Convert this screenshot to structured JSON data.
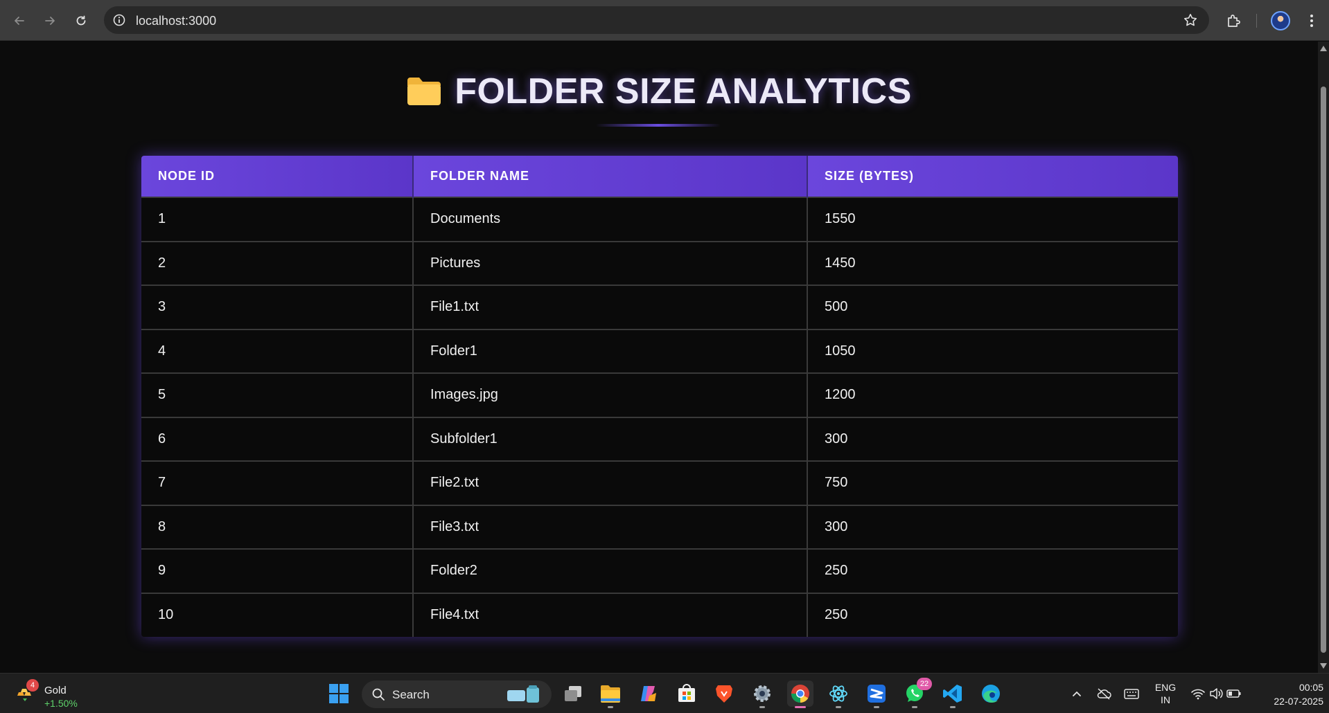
{
  "browser": {
    "url": "localhost:3000"
  },
  "page": {
    "title": "FOLDER SIZE ANALYTICS"
  },
  "table": {
    "headers": [
      "NODE ID",
      "FOLDER NAME",
      "SIZE (BYTES)"
    ],
    "rows": [
      [
        "1",
        "Documents",
        "1550"
      ],
      [
        "2",
        "Pictures",
        "1450"
      ],
      [
        "3",
        "File1.txt",
        "500"
      ],
      [
        "4",
        "Folder1",
        "1050"
      ],
      [
        "5",
        "Images.jpg",
        "1200"
      ],
      [
        "6",
        "Subfolder1",
        "300"
      ],
      [
        "7",
        "File2.txt",
        "750"
      ],
      [
        "8",
        "File3.txt",
        "300"
      ],
      [
        "9",
        "Folder2",
        "250"
      ],
      [
        "10",
        "File4.txt",
        "250"
      ]
    ]
  },
  "taskbar": {
    "widget": {
      "label": "Gold",
      "value": "+1.50%",
      "badge": "4"
    },
    "search_label": "Search",
    "whatsapp_badge": "22",
    "language": [
      "ENG",
      "IN"
    ],
    "time": "00:05",
    "date": "22-07-2025"
  },
  "colors": {
    "header_gradient_start": "#6b46dc",
    "header_gradient_end": "#5b36c9",
    "page_background": "#0c0c0c",
    "widget_positive": "#5ed26a"
  }
}
